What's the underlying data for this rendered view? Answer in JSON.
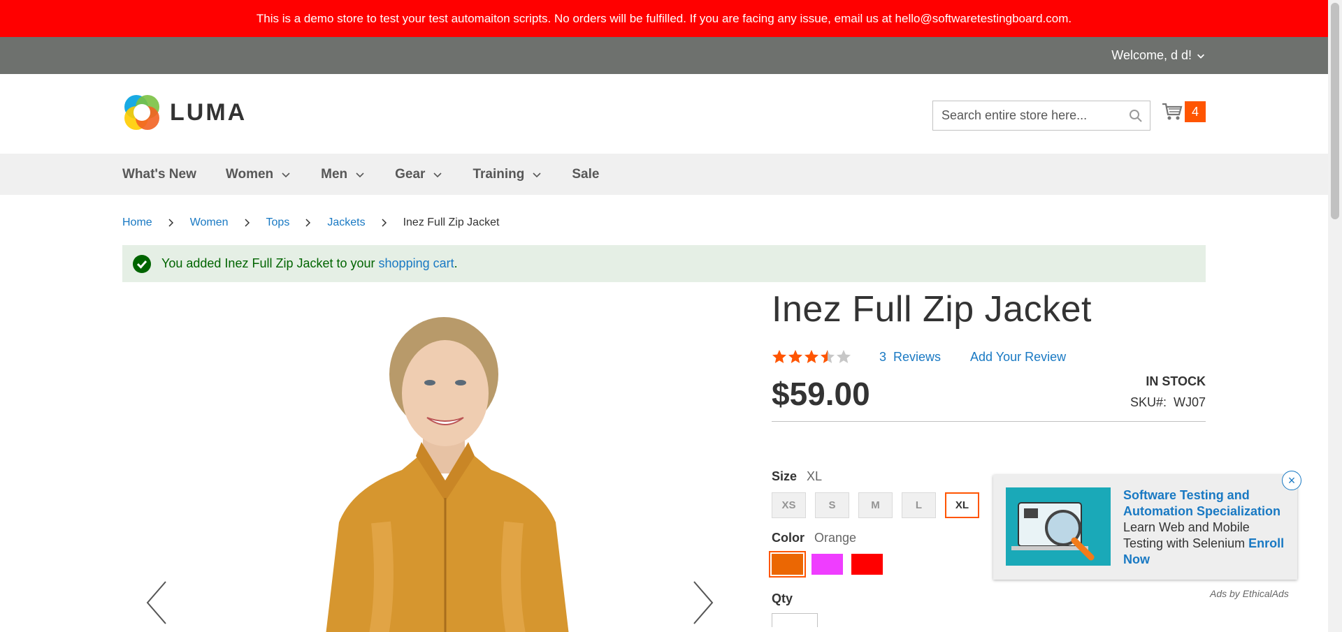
{
  "demo_notice": "This is a demo store to test your test automaiton scripts. No orders will be fulfilled. If you are facing any issue, email us at hello@softwaretestingboard.com.",
  "top_bar": {
    "welcome": "Welcome, d d!"
  },
  "header": {
    "logo_text": "LUMA",
    "search_placeholder": "Search entire store here...",
    "cart_count": "4"
  },
  "nav": {
    "items": [
      {
        "label": "What's New",
        "has_menu": false
      },
      {
        "label": "Women",
        "has_menu": true
      },
      {
        "label": "Men",
        "has_menu": true
      },
      {
        "label": "Gear",
        "has_menu": true
      },
      {
        "label": "Training",
        "has_menu": true
      },
      {
        "label": "Sale",
        "has_menu": false
      }
    ]
  },
  "breadcrumbs": [
    "Home",
    "Women",
    "Tops",
    "Jackets",
    "Inez Full Zip Jacket"
  ],
  "message": {
    "prefix": "You added Inez Full Zip Jacket to your ",
    "link": "shopping cart",
    "suffix": "."
  },
  "product": {
    "title": "Inez Full Zip Jacket",
    "rating_stars": 3.5,
    "rating_max": 5,
    "reviews_label": "3  Reviews",
    "add_review_label": "Add Your Review",
    "price": "$59.00",
    "stock": "In stock",
    "sku_label": "SKU#:",
    "sku_value": "WJ07",
    "size_label": "Size",
    "size_selected": "XL",
    "sizes": [
      "XS",
      "S",
      "M",
      "L",
      "XL"
    ],
    "color_label": "Color",
    "color_selected": "Orange",
    "colors": [
      {
        "name": "Orange",
        "hex": "#eb6703",
        "active": true
      },
      {
        "name": "Purple",
        "hex": "#ef3dff",
        "active": false
      },
      {
        "name": "Red",
        "hex": "#ff0000",
        "active": false
      }
    ],
    "qty_label": "Qty"
  },
  "ad": {
    "headline": "Software Testing and Automation Specialization",
    "body": "Learn Web and Mobile Testing with Selenium ",
    "cta": "Enroll Now",
    "close": "×",
    "by": "Ads by EthicalAds"
  },
  "colors": {
    "brand": "#ff5501",
    "link": "#1979c3",
    "demo_bar": "#ff0000",
    "top_bar": "#6e716e"
  }
}
